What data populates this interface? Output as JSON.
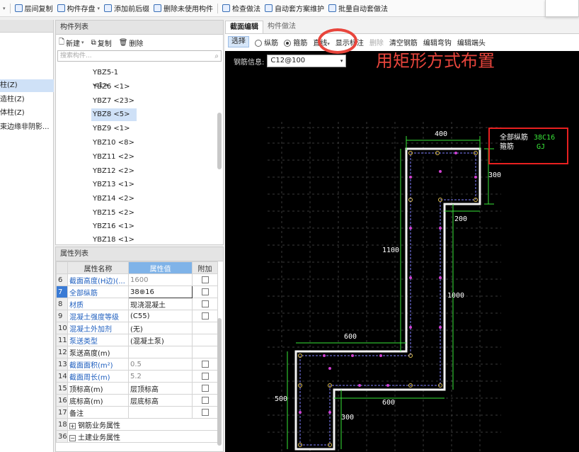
{
  "toolbar": {
    "items": [
      "层间复制",
      "构件存盘",
      "添加前后缀",
      "删除未使用构件",
      "检查做法",
      "自动套方案维护",
      "批量自动套做法"
    ]
  },
  "left_tree": {
    "items": [
      "柱(Z)",
      "造柱(Z)",
      "体柱(Z)",
      "束边缘非阴影..."
    ]
  },
  "component_list": {
    "title": "构件列表",
    "new_label": "新建",
    "copy_label": "复制",
    "delete_label": "删除",
    "search_placeholder": "搜索构件...",
    "items": [
      "YBZ5-1 <1>",
      "YBZ6 <1>",
      "YBZ7 <23>",
      "YBZ8 <5>",
      "YBZ9 <1>",
      "YBZ10 <8>",
      "YBZ11 <2>",
      "YBZ12 <2>",
      "YBZ13 <1>",
      "YBZ14 <2>",
      "YBZ15 <2>",
      "YBZ16 <1>",
      "YBZ18 <1>"
    ],
    "selected": "YBZ8 <5>"
  },
  "property_list": {
    "title": "属性列表",
    "headers": [
      "属性名称",
      "属性值",
      "附加"
    ],
    "rows": [
      {
        "num": "6",
        "name": "截面高度(H边)(...",
        "value": "1600",
        "check": true
      },
      {
        "num": "7",
        "name": "全部纵筋",
        "value": "38⊕16",
        "check": true
      },
      {
        "num": "8",
        "name": "材质",
        "value": "现浇混凝土",
        "check": true
      },
      {
        "num": "9",
        "name": "混凝土强度等级",
        "value": "(C55)",
        "check": true
      },
      {
        "num": "10",
        "name": "混凝土外加剂",
        "value": "(无)",
        "check": false
      },
      {
        "num": "11",
        "name": "泵送类型",
        "value": "(混凝土泵)",
        "check": false
      },
      {
        "num": "12",
        "name": "泵送高度(m)",
        "value": "",
        "check": false
      },
      {
        "num": "13",
        "name": "截面面积(m²)",
        "value": "0.5",
        "check": true
      },
      {
        "num": "14",
        "name": "截面周长(m)",
        "value": "5.2",
        "check": true
      },
      {
        "num": "15",
        "name": "顶标高(m)",
        "value": "层顶标高",
        "check": true
      },
      {
        "num": "16",
        "name": "底标高(m)",
        "value": "层底标高",
        "check": true
      },
      {
        "num": "17",
        "name": "备注",
        "value": "",
        "check": true
      },
      {
        "num": "18",
        "name": "钢筋业务属性",
        "value": "",
        "check": false
      },
      {
        "num": "36",
        "name": "土建业务属性",
        "value": "",
        "check": false
      }
    ]
  },
  "editor": {
    "tabs": [
      "截面编辑",
      "构件做法"
    ],
    "tools": {
      "select": "选择",
      "longitudinal": "纵筋",
      "stirrup": "箍筋",
      "line": "直线",
      "show_dim": "显示标注",
      "delete": "删除",
      "clear": "清空钢筋",
      "edit_hook": "编辑弯钩",
      "edit_end": "编辑端头"
    },
    "rebar_info_label": "钢筋信息:",
    "rebar_info_value": "C12@100",
    "annotation": "用矩形方式布置",
    "legend": {
      "all_long_label": "全部纵筋",
      "all_long_value": "38C16",
      "stirrup_label": "箍筋",
      "stirrup_value": "GJ"
    },
    "dimensions": [
      "400",
      "300",
      "200",
      "1100",
      "1000",
      "600",
      "600",
      "500",
      "300"
    ]
  }
}
